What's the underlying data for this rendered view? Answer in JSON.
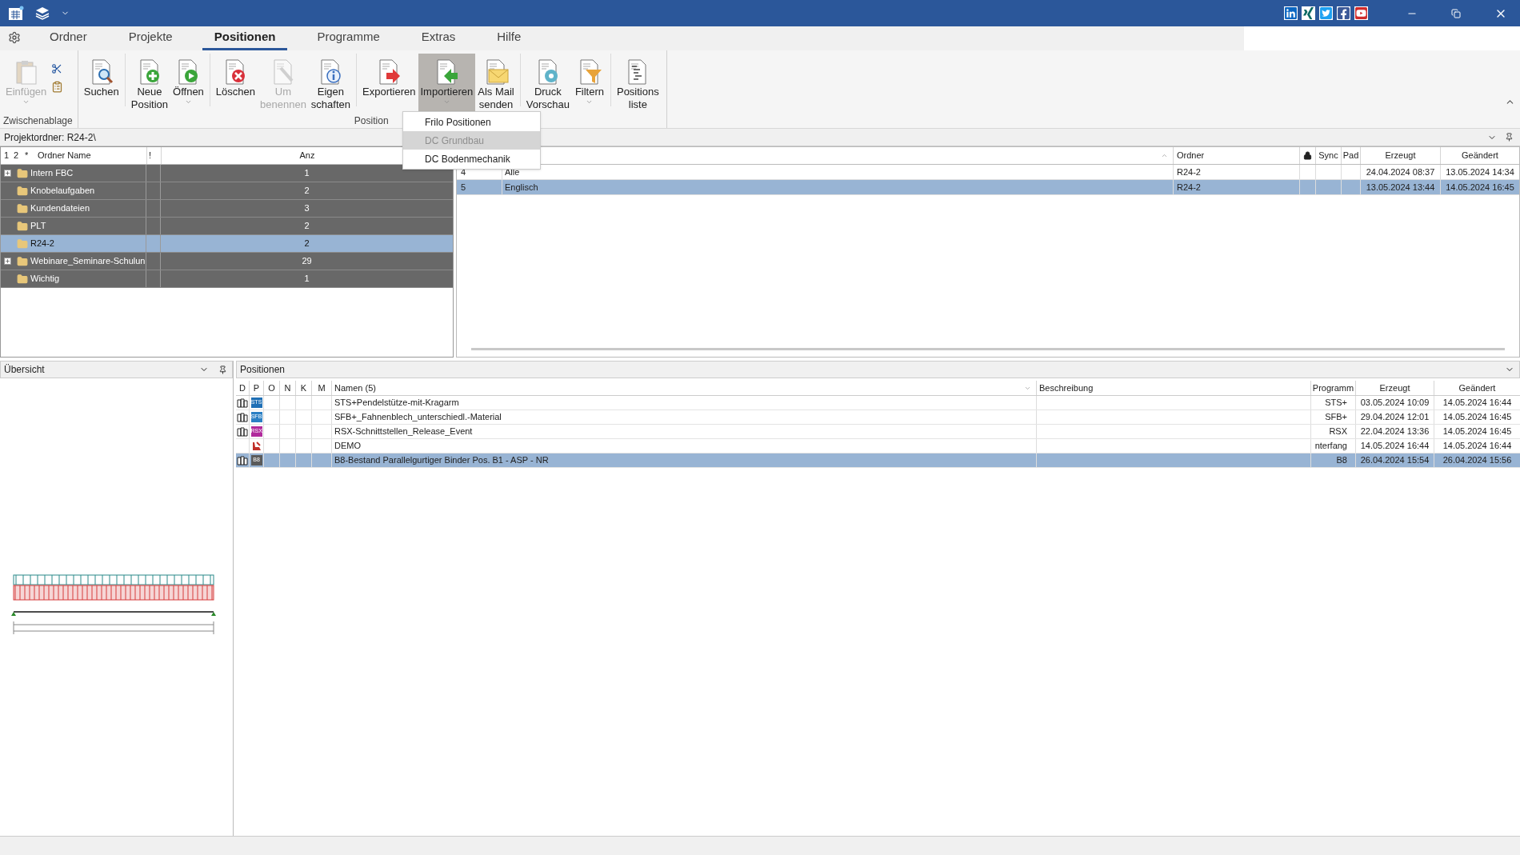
{
  "menu_tabs": [
    {
      "label": "Ordner",
      "selected": false
    },
    {
      "label": "Projekte",
      "selected": false
    },
    {
      "label": "Positionen",
      "selected": true
    },
    {
      "label": "Programme",
      "selected": false
    },
    {
      "label": "Extras",
      "selected": false
    },
    {
      "label": "Hilfe",
      "selected": false
    }
  ],
  "ribbon": {
    "groups": [
      {
        "label": "Zwischenablage",
        "clusters": [
          [
            {
              "kind": "paste",
              "label": "Einfügen",
              "disabled": true,
              "dropdown": true,
              "pressed": false
            }
          ]
        ],
        "small_tools": true
      },
      {
        "label": "Position",
        "small_tools": false,
        "clusters": [
          [
            {
              "kind": "search",
              "label": "Suchen",
              "disabled": false,
              "dropdown": false,
              "pressed": false
            }
          ],
          [
            {
              "kind": "new",
              "label": "Neue\nPosition",
              "disabled": false,
              "dropdown": false,
              "pressed": false
            },
            {
              "kind": "open",
              "label": "Öffnen",
              "disabled": false,
              "dropdown": true,
              "pressed": false
            }
          ],
          [
            {
              "kind": "delete",
              "label": "Löschen",
              "disabled": false,
              "dropdown": false,
              "pressed": false
            },
            {
              "kind": "rename",
              "label": "Um\nbenennen",
              "disabled": true,
              "dropdown": false,
              "pressed": false
            },
            {
              "kind": "properties",
              "label": "Eigen\nschaften",
              "disabled": false,
              "dropdown": false,
              "pressed": false
            }
          ],
          [
            {
              "kind": "export",
              "label": "Exportieren",
              "disabled": false,
              "dropdown": false,
              "pressed": false
            },
            {
              "kind": "import",
              "label": "Importieren",
              "disabled": false,
              "dropdown": true,
              "pressed": true
            },
            {
              "kind": "mail",
              "label": "Als Mail\nsenden",
              "disabled": false,
              "dropdown": false,
              "pressed": false
            }
          ],
          [
            {
              "kind": "preview",
              "label": "Druck\nVorschau",
              "disabled": false,
              "dropdown": false,
              "pressed": false
            },
            {
              "kind": "filter",
              "label": "Filtern",
              "disabled": false,
              "dropdown": true,
              "pressed": false
            }
          ],
          [
            {
              "kind": "list",
              "label": "Positions\nliste",
              "disabled": false,
              "dropdown": false,
              "pressed": false
            }
          ]
        ]
      }
    ]
  },
  "import_menu": [
    {
      "label": "Frilo Positionen",
      "highlighted": false,
      "disabled": false
    },
    {
      "label": "DC Grundbau",
      "highlighted": true,
      "disabled": true
    },
    {
      "label": "DC Bodenmechanik",
      "highlighted": false,
      "disabled": false
    }
  ],
  "folder_bar": {
    "path": "Projektordner: R24-2\\"
  },
  "folder_tree": {
    "columns": [
      "1",
      "2",
      "*",
      "Ordner Name",
      "!",
      "Anz"
    ],
    "rows": [
      {
        "name": "Intern FBC",
        "count": "1",
        "expandable": true,
        "selected": false
      },
      {
        "name": "Knobelaufgaben",
        "count": "2",
        "expandable": false,
        "selected": false
      },
      {
        "name": "Kundendateien",
        "count": "3",
        "expandable": false,
        "selected": false
      },
      {
        "name": "PLT",
        "count": "2",
        "expandable": false,
        "selected": false
      },
      {
        "name": "R24-2",
        "count": "2",
        "expandable": false,
        "selected": true
      },
      {
        "name": "Webinare_Seminare-Schulun",
        "count": "29",
        "expandable": true,
        "selected": false
      },
      {
        "name": "Wichtig",
        "count": "1",
        "expandable": false,
        "selected": false
      }
    ]
  },
  "subfolder_table": {
    "columns": [
      "Ordner",
      "Sync",
      "Pad",
      "Erzeugt",
      "Geändert"
    ],
    "rows": [
      {
        "number": "4",
        "name": "Alle",
        "folder": "R24-2",
        "created": "24.04.2024 08:37",
        "changed": "13.05.2024 14:34",
        "selected": false
      },
      {
        "number": "5",
        "name": "Englisch",
        "folder": "R24-2",
        "created": "13.05.2024 13:44",
        "changed": "14.05.2024 16:45",
        "selected": true
      }
    ]
  },
  "overview_panel": {
    "title": "Übersicht"
  },
  "positions_panel": {
    "title": "Positionen",
    "columns": [
      "D",
      "P",
      "O",
      "N",
      "K",
      "M",
      "Namen (5)",
      "Beschreibung",
      "Programm",
      "Erzeugt",
      "Geändert"
    ],
    "rows": [
      {
        "document": true,
        "kind": "badge",
        "badge": "STS",
        "color": "#1f6fb5",
        "name": "STS+Pendelstütze-mit-Kragarm",
        "program": "STS+",
        "created": "03.05.2024 10:09",
        "changed": "14.05.2024 16:44",
        "selected": false
      },
      {
        "document": true,
        "kind": "badge",
        "badge": "SFB",
        "color": "#2a7fc4",
        "name": "SFB+_Fahnenblech_unterschiedl.-Material",
        "program": "SFB+",
        "created": "29.04.2024 12:01",
        "changed": "14.05.2024 16:45",
        "selected": false
      },
      {
        "document": true,
        "kind": "badge",
        "badge": "RSX",
        "color": "#b02a9c",
        "name": "RSX-Schnittstellen_Release_Event",
        "program": "RSX",
        "created": "22.04.2024 13:36",
        "changed": "14.05.2024 16:45",
        "selected": false
      },
      {
        "document": false,
        "kind": "tool",
        "name": "DEMO",
        "program": "nterfang",
        "created": "14.05.2024 16:44",
        "changed": "14.05.2024 16:44",
        "selected": false
      },
      {
        "document": true,
        "kind": "badge",
        "badge": "B8",
        "color": "#5a5a5a",
        "name": "B8-Bestand Parallelgurtiger Binder Pos. B1 - ASP - NR",
        "program": "B8",
        "created": "26.04.2024 15:54",
        "changed": "26.04.2024 15:56",
        "selected": true
      }
    ]
  }
}
